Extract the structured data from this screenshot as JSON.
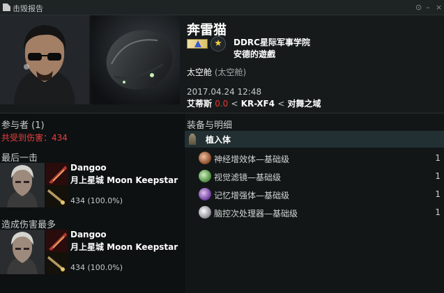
{
  "window": {
    "title": "击毁报告"
  },
  "victim": {
    "name": "奔雷猫",
    "corporation": "DDRC星际军事学院",
    "alliance": "安德的遊戲",
    "ship_name": "太空舱",
    "ship_type": "(太空舱)",
    "datetime": "2017.04.24 12:48",
    "region": "艾蒂斯",
    "security": "0.0",
    "constellation": "KR-XF4",
    "system": "对舞之域",
    "separator": "<"
  },
  "participants": {
    "title": "参与者 (1)",
    "damage_taken_label": "共受到伤害：434",
    "final_blow": {
      "label": "最后一击",
      "name": "Dangoo",
      "corp": "月上星城 Moon Keepstar",
      "damage": "434 (100.0%)"
    },
    "top_damage": {
      "label": "造成伤害最多",
      "name": "Dangoo",
      "corp": "月上星城 Moon Keepstar",
      "damage": "434 (100.0%)"
    }
  },
  "fitting": {
    "title": "装备与明细",
    "group": {
      "label": "植入体",
      "icon": "implant-icon"
    },
    "items": [
      {
        "name": "神经增效体—基础级",
        "qty": "1",
        "icon": "cybernetic-subprocessor-icon",
        "color": "#c8865a"
      },
      {
        "name": "视觉滤镜—基础级",
        "qty": "1",
        "icon": "ocular-filter-icon",
        "color": "#7fc86a"
      },
      {
        "name": "记忆增强体—基础级",
        "qty": "1",
        "icon": "memory-augmentation-icon",
        "color": "#9a6ad0"
      },
      {
        "name": "脑控次处理器—基础级",
        "qty": "1",
        "icon": "neural-boost-icon",
        "color": "#b8b8c0"
      }
    ]
  }
}
